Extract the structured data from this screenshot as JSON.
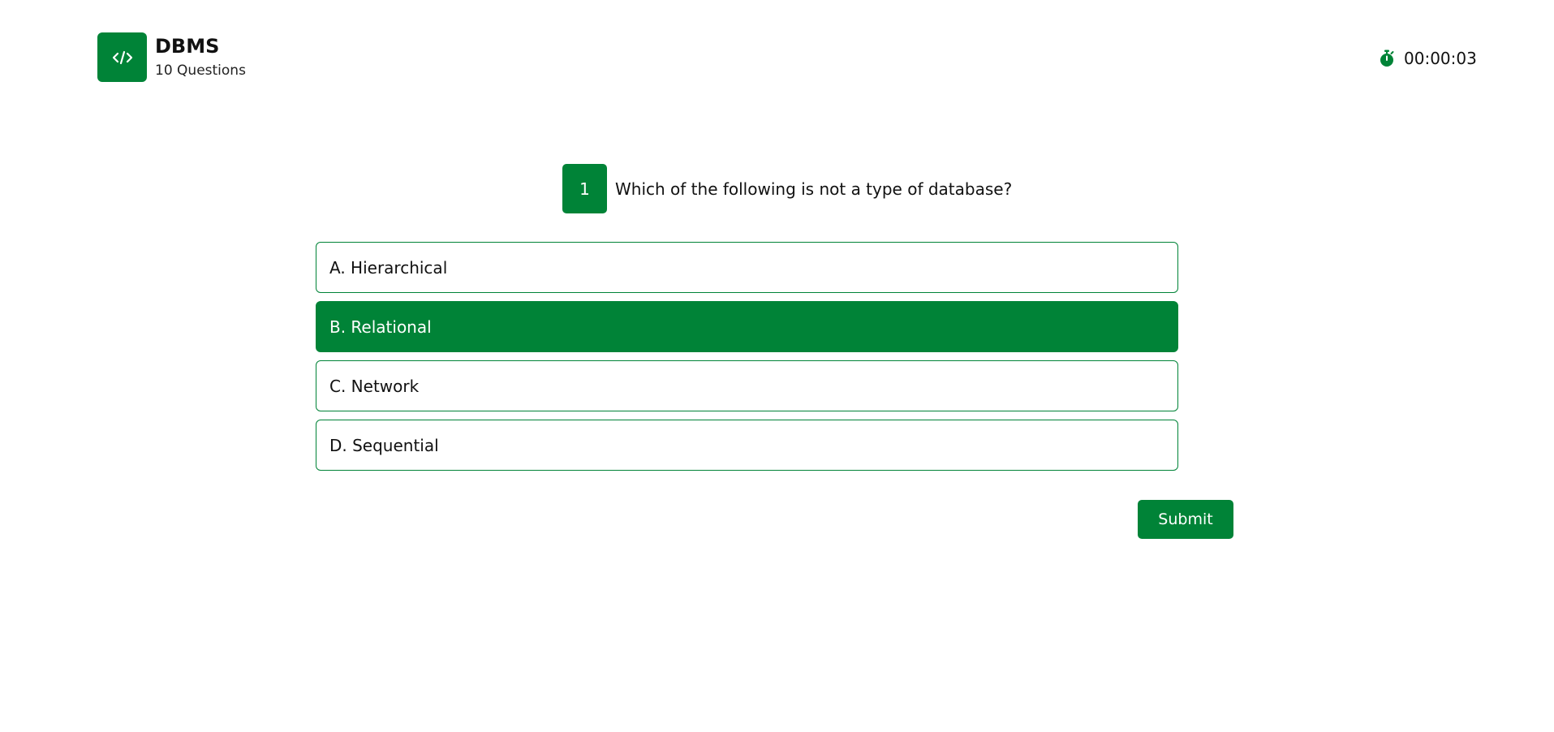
{
  "brand": {
    "icon": "code-icon",
    "title": "DBMS",
    "subtitle": "10 Questions"
  },
  "timer": {
    "icon": "stopwatch-icon",
    "value": "00:00:03"
  },
  "question": {
    "number": "1",
    "text": "Which of the following is not a type of database?"
  },
  "options": [
    {
      "label": "A. Hierarchical",
      "selected": false
    },
    {
      "label": "B. Relational",
      "selected": true
    },
    {
      "label": "C. Network",
      "selected": false
    },
    {
      "label": "D. Sequential",
      "selected": false
    }
  ],
  "submit_label": "Submit",
  "colors": {
    "accent": "#008337",
    "background": "#ffffff",
    "text": "#111111"
  }
}
